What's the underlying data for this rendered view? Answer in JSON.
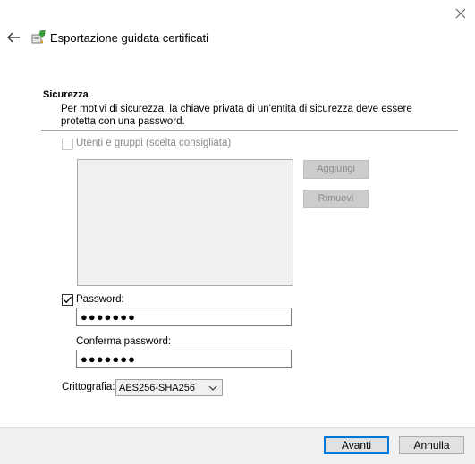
{
  "window": {
    "title": "Esportazione guidata certificati",
    "close_icon": "close-icon",
    "back_icon": "back-arrow-icon"
  },
  "section": {
    "heading": "Sicurezza",
    "description": "Per motivi di sicurezza, la chiave privata di un'entità di sicurezza deve essere protetta con una password."
  },
  "users_groups": {
    "label": "Utenti e gruppi (scelta consigliata)",
    "checked": false,
    "enabled": false,
    "add_label": "Aggiungi",
    "remove_label": "Rimuovi"
  },
  "password": {
    "label": "Password:",
    "checked": true,
    "value": "●●●●●●●",
    "confirm_label": "Conferma password:",
    "confirm_value": "●●●●●●●"
  },
  "encryption": {
    "label": "Crittografia:",
    "selected": "AES256-SHA256"
  },
  "footer": {
    "next_label": "Avanti",
    "cancel_label": "Annulla"
  },
  "colors": {
    "accent": "#0078d7",
    "footer_bg": "#f0f0f0",
    "disabled_text": "#8a8a8a"
  }
}
